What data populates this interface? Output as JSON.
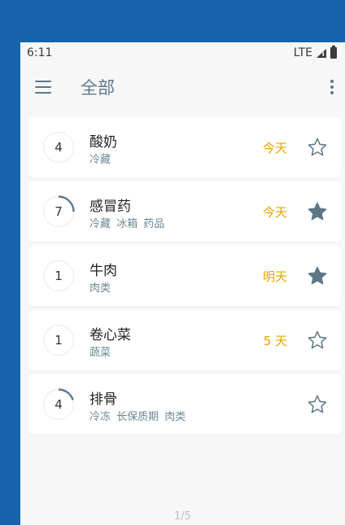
{
  "status_bar": {
    "time": "6:11",
    "network": "LTE"
  },
  "app_bar": {
    "title": "全部",
    "menu_icon": "hamburger-menu-icon",
    "more_icon": "more-vertical-icon"
  },
  "items": [
    {
      "count": "4",
      "progress": 0.0,
      "name": "酸奶",
      "tags": "冷藏",
      "expiry": "今天",
      "starred": false
    },
    {
      "count": "7",
      "progress": 0.25,
      "name": "感冒药",
      "tags": "冷藏 冰箱 药品",
      "expiry": "今天",
      "starred": true
    },
    {
      "count": "1",
      "progress": 0.0,
      "name": "牛肉",
      "tags": "肉类",
      "expiry": "明天",
      "starred": true
    },
    {
      "count": "1",
      "progress": 0.0,
      "name": "卷心菜",
      "tags": "蔬菜",
      "expiry": "5 天",
      "starred": false
    },
    {
      "count": "4",
      "progress": 0.2,
      "name": "排骨",
      "tags": "冷冻 长保质期 肉类",
      "expiry": "",
      "starred": false
    }
  ],
  "colors": {
    "accent": "#5d7786",
    "expiry": "#e8a500",
    "background": "#1762a8",
    "ring_track": "#eeeeee"
  },
  "page_indicator": "1/5"
}
